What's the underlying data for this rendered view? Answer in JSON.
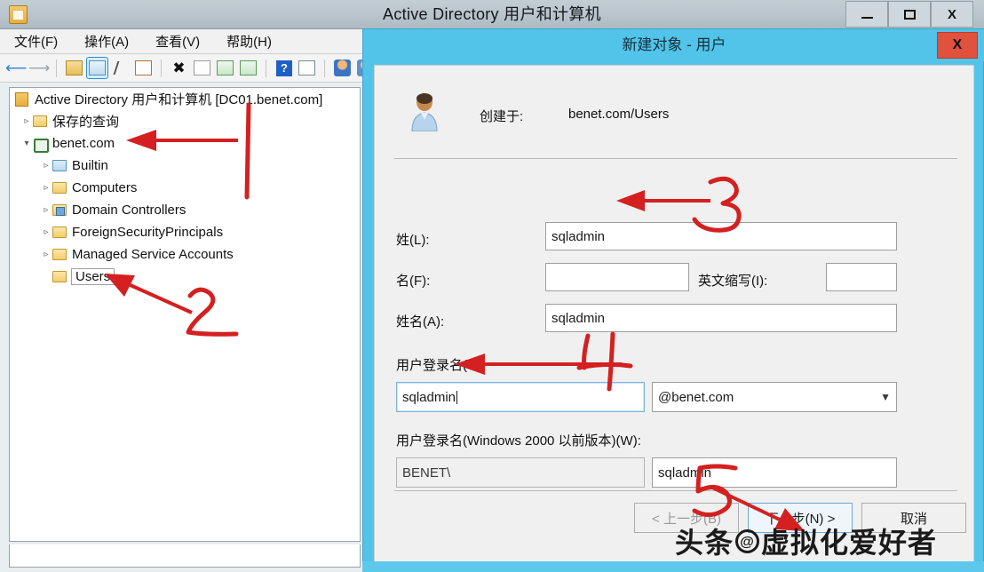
{
  "main_window": {
    "title": "Active Directory 用户和计算机",
    "app_icon": "console-icon",
    "window_buttons": {
      "minimize": "minimize-icon",
      "maximize": "maximize-icon",
      "close": "X"
    },
    "menu": [
      {
        "label": "文件(F)"
      },
      {
        "label": "操作(A)"
      },
      {
        "label": "查看(V)"
      },
      {
        "label": "帮助(H)"
      }
    ],
    "toolbar": [
      {
        "name": "back-icon",
        "glyph": "⇦"
      },
      {
        "name": "forward-icon",
        "glyph": "⇨"
      },
      {
        "name": "up-folder-icon"
      },
      {
        "name": "show-hide-console-tree-icon"
      },
      {
        "name": "cut-icon"
      },
      {
        "name": "paste-icon"
      },
      {
        "name": "delete-icon",
        "glyph": "✖"
      },
      {
        "name": "properties-icon"
      },
      {
        "name": "refresh-icon"
      },
      {
        "name": "export-list-icon"
      },
      {
        "name": "help-icon",
        "glyph": "?"
      },
      {
        "name": "show-details-pane-icon"
      },
      {
        "name": "new-user-icon"
      },
      {
        "name": "new-group-icon"
      },
      {
        "name": "new-contact-icon"
      }
    ],
    "tree": [
      {
        "label": "Active Directory 用户和计算机 [DC01.benet.com]",
        "indent": 0,
        "chevron": "",
        "icon": "console-root-icon",
        "selected": false
      },
      {
        "label": "保存的查询",
        "indent": 1,
        "chevron": "▹",
        "icon": "folder-icon",
        "selected": false
      },
      {
        "label": "benet.com",
        "indent": 1,
        "chevron": "▾",
        "icon": "domain-icon",
        "selected": false
      },
      {
        "label": "Builtin",
        "indent": 2,
        "chevron": "▹",
        "icon": "folder-builtin-icon",
        "selected": false
      },
      {
        "label": "Computers",
        "indent": 2,
        "chevron": "▹",
        "icon": "folder-icon",
        "selected": false
      },
      {
        "label": "Domain Controllers",
        "indent": 2,
        "chevron": "▹",
        "icon": "folder-ou-icon",
        "selected": false
      },
      {
        "label": "ForeignSecurityPrincipals",
        "indent": 2,
        "chevron": "▹",
        "icon": "folder-icon",
        "selected": false
      },
      {
        "label": "Managed Service Accounts",
        "indent": 2,
        "chevron": "▹",
        "icon": "folder-icon",
        "selected": false
      },
      {
        "label": "Users",
        "indent": 2,
        "chevron": "",
        "icon": "folder-icon",
        "selected": true
      }
    ]
  },
  "dialog": {
    "title": "新建对象 - 用户",
    "close_label": "X",
    "avatar_icon": "user-avatar-icon",
    "created_in_label": "创建于:",
    "created_in_value": "benet.com/Users",
    "fields": {
      "last_name_label": "姓(L):",
      "last_name_value": "sqladmin",
      "first_name_label": "名(F):",
      "first_name_value": "",
      "initials_label": "英文缩写(I):",
      "initials_value": "",
      "full_name_label": "姓名(A):",
      "full_name_value": "sqladmin",
      "upn_label": "用户登录名(U):",
      "upn_value": "sqladmin",
      "upn_suffix_value": "@benet.com",
      "sam_label": "用户登录名(Windows 2000 以前版本)(W):",
      "sam_domain_value": "BENET\\",
      "sam_value": "sqladmin"
    },
    "buttons": {
      "back": "< 上一步(B)",
      "next": "下一步(N) >",
      "cancel": "取消"
    }
  },
  "annotations": {
    "marks": [
      "1",
      "2",
      "3",
      "4",
      "5"
    ],
    "color": "#d42020"
  },
  "watermark": {
    "prefix": "头条",
    "at": "@",
    "suffix": "虚拟化爱好者"
  }
}
